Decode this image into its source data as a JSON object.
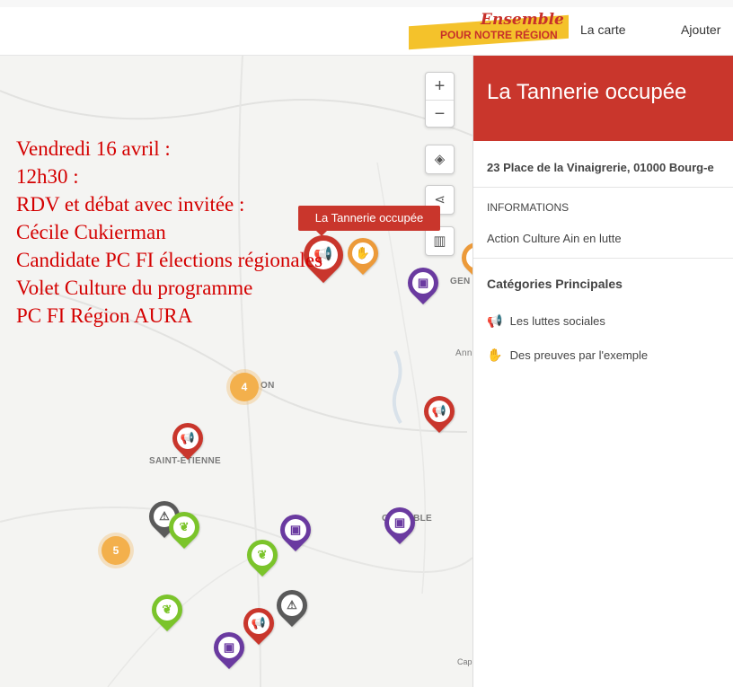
{
  "header": {
    "logo_script": "Ensemble",
    "logo_sub": "POUR NOTRE RÉGION",
    "nav": [
      {
        "label": "La carte"
      },
      {
        "label": "Ajouter"
      }
    ]
  },
  "map": {
    "zoom_in": "+",
    "zoom_out": "−",
    "tooltip": "La Tannerie occupée",
    "cities": [
      "GEN",
      "Ann",
      "ON",
      "SAINT-ÉTIENNE",
      "G",
      "OBLE"
    ],
    "clusters": [
      "4",
      "5"
    ],
    "attribution": "Cap",
    "icons": {
      "protest": "megaphone-icon",
      "example": "handshake-icon",
      "transport": "bus-icon",
      "ecology": "leaf-icon",
      "warning": "warning-icon"
    },
    "colors": {
      "red": "#c9362c",
      "purple": "#6a3aa0",
      "green": "#7bc42b",
      "grey": "#5a5a5a",
      "orange": "#ec9a3a"
    }
  },
  "overlay_text": [
    "Vendredi 16 avril :",
    "12h30 :",
    "RDV et débat avec invitée :",
    "Cécile Cukierman",
    "Candidate PC FI élections régionales",
    "Volet Culture du programme",
    "PC FI Région AURA"
  ],
  "panel": {
    "title": "La Tannerie occupée",
    "address": "23 Place de la Vinaigrerie, 01000 Bourg-e",
    "info_heading": "INFORMATIONS",
    "info_value": "Action Culture Ain en lutte",
    "categories_heading": "Catégories Principales",
    "categories": [
      {
        "label": "Les luttes sociales",
        "icon": "megaphone-icon"
      },
      {
        "label": "Des preuves par l'exemple",
        "icon": "handshake-icon"
      }
    ],
    "header_color": "#c9362c"
  }
}
